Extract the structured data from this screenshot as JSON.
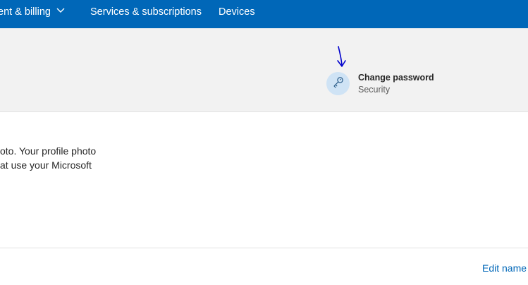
{
  "nav": {
    "items": [
      {
        "label": "ent & billing",
        "has_chevron": true
      },
      {
        "label": "Services & subscriptions"
      },
      {
        "label": "Devices"
      }
    ]
  },
  "quick_link": {
    "icon": "key-icon",
    "title": "Change password",
    "subtitle": "Security"
  },
  "profile": {
    "line1": "oto. Your profile photo",
    "line2": "at use your Microsoft"
  },
  "name_section": {
    "edit_label": "Edit name"
  },
  "colors": {
    "nav_bg": "#0067b8",
    "band_bg": "#f2f2f2",
    "link": "#0067b8",
    "key_circle": "#cfe3f5",
    "annotation": "#0000cc"
  }
}
